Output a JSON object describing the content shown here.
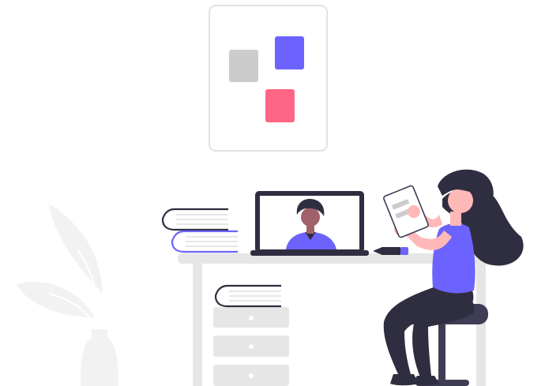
{
  "colors": {
    "accent": "#6c63ff",
    "pink": "#ff6584",
    "dark": "#2f2e41",
    "skin": "#ffb8b8",
    "light_gray": "#e6e6e6",
    "mid_gray": "#cccccc",
    "panel_border": "#e3e3e3",
    "page_gray": "#f2f2f2",
    "face_brown": "#a0616a"
  },
  "icons": {
    "board": "wall-board-icon",
    "plant": "plant-icon",
    "laptop": "laptop-icon",
    "books": "book-stack-icon",
    "paper": "paper-icon",
    "pen": "pen-icon"
  }
}
